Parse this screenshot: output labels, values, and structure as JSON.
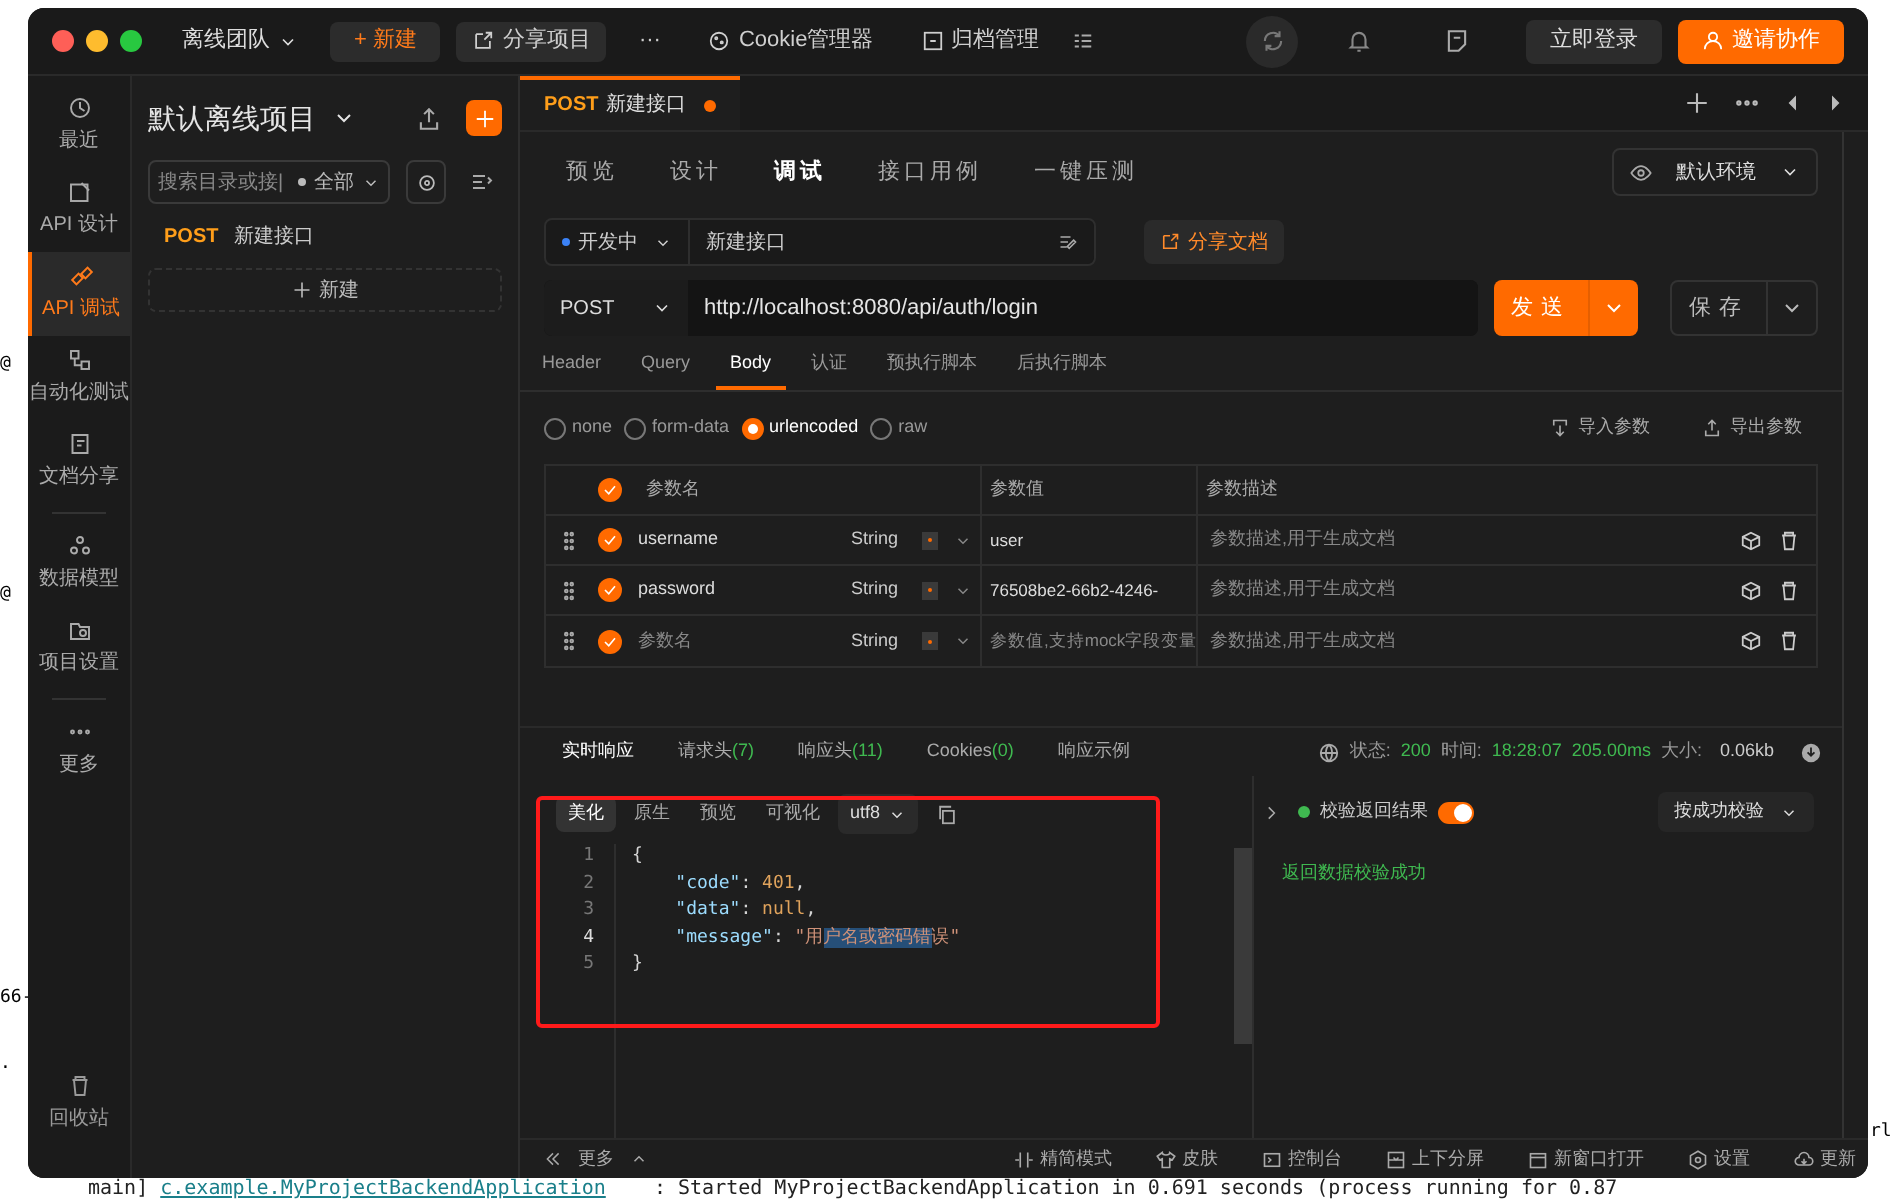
{
  "background": {
    "fragments": [
      "@",
      "@",
      "66-",
      ".",
      "rl"
    ],
    "console_line": [
      {
        "t": "main] ",
        "kind": "plain"
      },
      {
        "t": "c.example.MyProjectBackendApplication",
        "kind": "class"
      },
      {
        "t": "    : Started MyProjectBackendApplication in 0.691 seconds (process running for 0.87",
        "kind": "plain"
      }
    ]
  },
  "titlebar": {
    "team": "离线团队",
    "new_button": "+ 新建",
    "items": [
      {
        "label": "分享项目"
      },
      {
        "label": "···"
      },
      {
        "label": "Cookie管理器"
      },
      {
        "label": "归档管理"
      }
    ],
    "login": "立即登录",
    "invite": "邀请协作"
  },
  "nav": {
    "items": [
      {
        "label": "最近",
        "selected": false
      },
      {
        "label": "API 设计",
        "selected": false
      },
      {
        "label": "API 调试",
        "selected": true
      },
      {
        "label": "自动化测试",
        "selected": false
      },
      {
        "label": "文档分享",
        "selected": false
      },
      {
        "label": "数据模型",
        "selected": false
      },
      {
        "label": "项目设置",
        "selected": false
      },
      {
        "label": "更多",
        "selected": false
      }
    ],
    "trash": "回收站"
  },
  "project": {
    "title": "默认离线项目",
    "search_placeholder": "搜索目录或接|",
    "filter": "全部",
    "items": [
      {
        "method": "POST",
        "name": "新建接口"
      }
    ],
    "new_button": "新建"
  },
  "tabs": [
    {
      "method": "POST",
      "title": "新建接口",
      "modified": true,
      "selected": true
    }
  ],
  "mode_tabs": [
    {
      "label": "预览",
      "selected": false
    },
    {
      "label": "设计",
      "selected": false
    },
    {
      "label": "调试",
      "selected": true
    },
    {
      "label": "接口用例",
      "selected": false
    },
    {
      "label": "一键压测",
      "selected": false
    }
  ],
  "environment": "默认环境",
  "request": {
    "status": "开发中",
    "name": "新建接口",
    "share_button": "分享文档",
    "method": "POST",
    "url": "http://localhost:8080/api/auth/login",
    "send": "发送",
    "save": "保存"
  },
  "request_tabs": [
    {
      "label": "Header",
      "selected": false
    },
    {
      "label": "Query",
      "selected": false
    },
    {
      "label": "Body",
      "selected": true
    },
    {
      "label": "认证",
      "selected": false
    },
    {
      "label": "预执行脚本",
      "selected": false
    },
    {
      "label": "后执行脚本",
      "selected": false
    }
  ],
  "body_types": [
    {
      "label": "none",
      "selected": false
    },
    {
      "label": "form-data",
      "selected": false
    },
    {
      "label": "urlencoded",
      "selected": true
    },
    {
      "label": "raw",
      "selected": false
    }
  ],
  "import_button": "导入参数",
  "export_button": "导出参数",
  "params": {
    "columns": [
      "参数名",
      "参数值",
      "参数描述"
    ],
    "all_checked": true,
    "rows": [
      {
        "checked": true,
        "name": "username",
        "name_placeholder": false,
        "type": "String",
        "value": "user",
        "value_placeholder": false,
        "description": "参数描述,用于生成文档"
      },
      {
        "checked": true,
        "name": "password",
        "name_placeholder": false,
        "type": "String",
        "value": "76508be2-66b2-4246-",
        "value_placeholder": false,
        "description": "参数描述,用于生成文档"
      },
      {
        "checked": true,
        "name": "参数名",
        "name_placeholder": true,
        "type": "String",
        "value": "参数值,支持mock字段变量",
        "value_placeholder": true,
        "description": "参数描述,用于生成文档"
      }
    ]
  },
  "response_tabs": [
    {
      "label": "实时响应",
      "selected": true
    },
    {
      "label": "请求头",
      "count": "(7)",
      "selected": false
    },
    {
      "label": "响应头",
      "count": "(11)",
      "selected": false
    },
    {
      "label": "Cookies",
      "count": "(0)",
      "selected": false
    },
    {
      "label": "响应示例",
      "selected": false
    }
  ],
  "response_status": {
    "status_label": "状态:",
    "status": "200",
    "time_label": "时间:",
    "time": "18:28:07",
    "duration": "205.00ms",
    "size_label": "大小:",
    "size": "0.06kb"
  },
  "view_modes": [
    {
      "label": "美化",
      "selected": true
    },
    {
      "label": "原生",
      "selected": false
    },
    {
      "label": "预览",
      "selected": false
    },
    {
      "label": "可视化",
      "selected": false
    }
  ],
  "encoding": "utf8",
  "code": [
    {
      "no": "1",
      "tokens": [
        {
          "t": "{",
          "kind": "punct"
        }
      ]
    },
    {
      "no": "2",
      "tokens": [
        {
          "t": "    \"code\"",
          "kind": "key"
        },
        {
          "t": ": ",
          "kind": "punct"
        },
        {
          "t": "401",
          "kind": "number"
        },
        {
          "t": ",",
          "kind": "punct"
        }
      ]
    },
    {
      "no": "3",
      "tokens": [
        {
          "t": "    \"data\"",
          "kind": "key"
        },
        {
          "t": ": ",
          "kind": "punct"
        },
        {
          "t": "null",
          "kind": "number"
        },
        {
          "t": ",",
          "kind": "punct"
        }
      ]
    },
    {
      "no": "4",
      "tokens": [
        {
          "t": "    \"message\"",
          "kind": "key"
        },
        {
          "t": ": ",
          "kind": "punct"
        },
        {
          "t": "\"用",
          "kind": "string"
        },
        {
          "t": "户名或密码错",
          "kind": "selected"
        },
        {
          "t": "误\"",
          "kind": "string"
        }
      ]
    },
    {
      "no": "5",
      "tokens": [
        {
          "t": "}",
          "kind": "punct"
        }
      ]
    }
  ],
  "validation": {
    "label": "校验返回结果",
    "on": true,
    "mode": "按成功校验",
    "result": "返回数据校验成功"
  },
  "annotation": {
    "highlight_box": true
  },
  "footer": {
    "more": "更多",
    "items": [
      {
        "label": "精简模式"
      },
      {
        "label": "皮肤"
      },
      {
        "label": "控制台"
      },
      {
        "label": "上下分屏"
      },
      {
        "label": "新窗口打开"
      },
      {
        "label": "设置"
      },
      {
        "label": "更新"
      }
    ]
  }
}
